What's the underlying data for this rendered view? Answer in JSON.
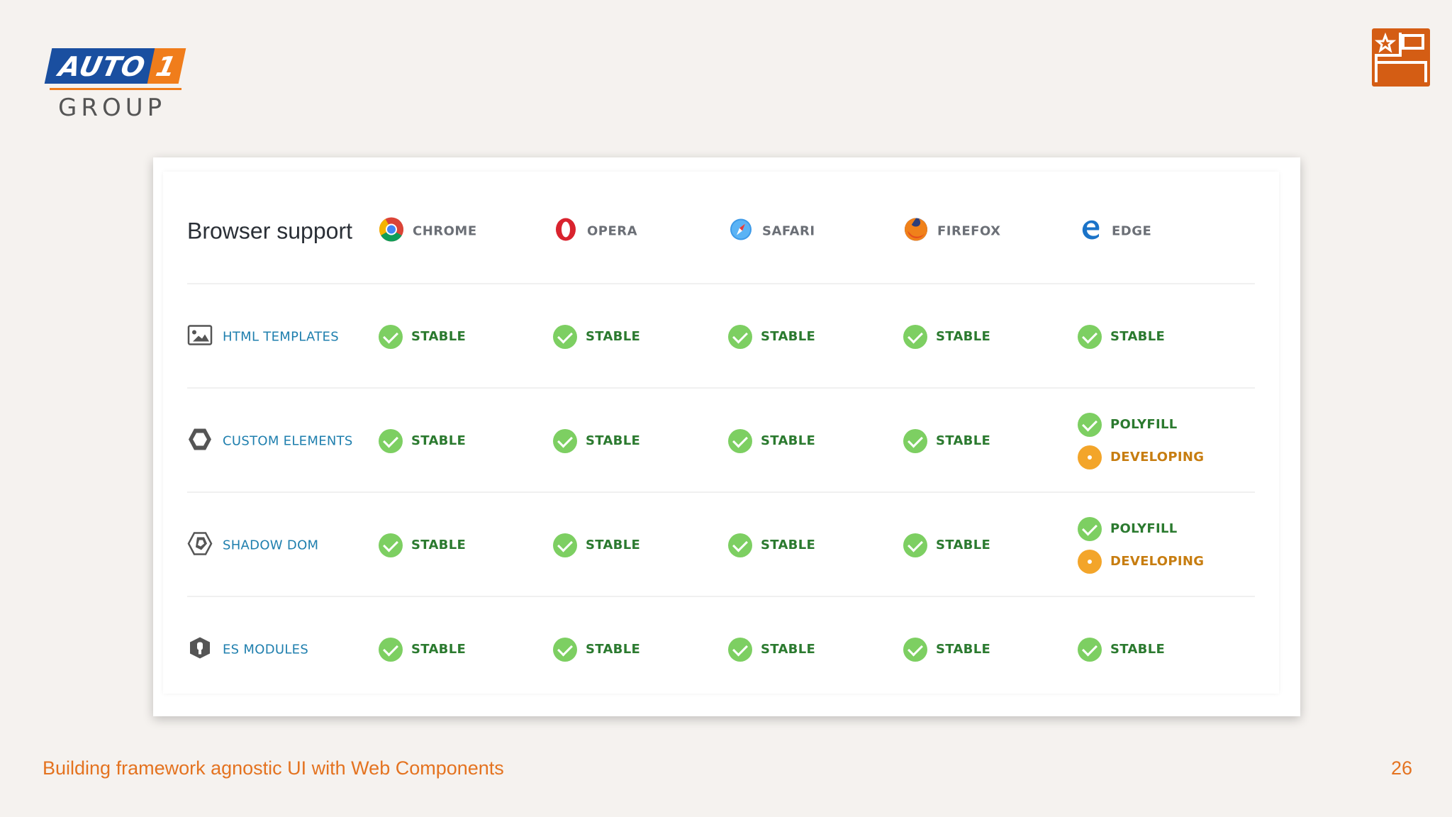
{
  "logo": {
    "auto": "AUTO",
    "one": "1",
    "group": "GROUP"
  },
  "table": {
    "title": "Browser support",
    "browsers": [
      "CHROME",
      "OPERA",
      "SAFARI",
      "FIREFOX",
      "EDGE"
    ],
    "features": [
      {
        "name": "HTML TEMPLATES",
        "icon": "image-template-icon",
        "cells": [
          [
            "STABLE"
          ],
          [
            "STABLE"
          ],
          [
            "STABLE"
          ],
          [
            "STABLE"
          ],
          [
            "STABLE"
          ]
        ]
      },
      {
        "name": "CUSTOM ELEMENTS",
        "icon": "hexagon-icon",
        "cells": [
          [
            "STABLE"
          ],
          [
            "STABLE"
          ],
          [
            "STABLE"
          ],
          [
            "STABLE"
          ],
          [
            "POLYFILL",
            "DEVELOPING"
          ]
        ]
      },
      {
        "name": "SHADOW DOM",
        "icon": "shadow-hexagon-icon",
        "cells": [
          [
            "STABLE"
          ],
          [
            "STABLE"
          ],
          [
            "STABLE"
          ],
          [
            "STABLE"
          ],
          [
            "POLYFILL",
            "DEVELOPING"
          ]
        ]
      },
      {
        "name": "ES MODULES",
        "icon": "module-shield-icon",
        "cells": [
          [
            "STABLE"
          ],
          [
            "STABLE"
          ],
          [
            "STABLE"
          ],
          [
            "STABLE"
          ],
          [
            "STABLE"
          ]
        ]
      }
    ]
  },
  "colors": {
    "accent": "#e47320",
    "stable": "#7dcf62",
    "developing": "#f3a52a",
    "feature_text": "#1f7fae"
  },
  "footer": {
    "title": "Building framework agnostic UI with Web Components",
    "page": "26"
  }
}
